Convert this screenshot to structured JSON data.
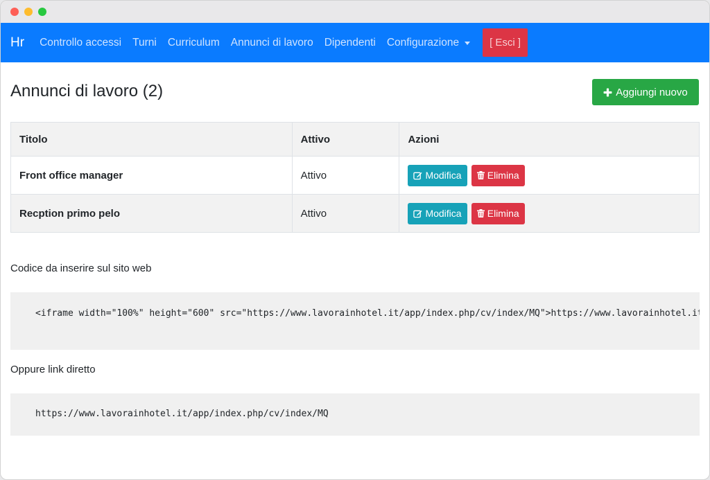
{
  "navbar": {
    "brand": "Hr",
    "items": [
      {
        "label": "Controllo accessi"
      },
      {
        "label": "Turni"
      },
      {
        "label": "Curriculum"
      },
      {
        "label": "Annunci di lavoro"
      },
      {
        "label": "Dipendenti"
      },
      {
        "label": "Configurazione"
      }
    ],
    "logout_label": "[ Esci ]"
  },
  "page": {
    "title": "Annunci di lavoro (2)",
    "add_button_label": "Aggiungi nuovo"
  },
  "table": {
    "headers": [
      "Titolo",
      "Attivo",
      "Azioni"
    ],
    "rows": [
      {
        "title": "Front office manager",
        "status": "Attivo"
      },
      {
        "title": "Recption primo pelo",
        "status": "Attivo"
      }
    ],
    "edit_label": "Modifica",
    "delete_label": "Elimina"
  },
  "embed": {
    "label": "Codice da inserire sul sito web",
    "code": "<iframe width=\"100%\" height=\"600\" src=\"https://www.lavorainhotel.it/app/index.php/cv/index/MQ\">https://www.lavorainhotel.it/app/index.php/cv/index/MQ</iframe>"
  },
  "direct_link": {
    "label": "Oppure link diretto",
    "url": "https://www.lavorainhotel.it/app/index.php/cv/index/MQ"
  },
  "colors": {
    "navbar": "#0a7bff",
    "success": "#28a745",
    "info": "#17a2b8",
    "danger": "#dc3545"
  }
}
